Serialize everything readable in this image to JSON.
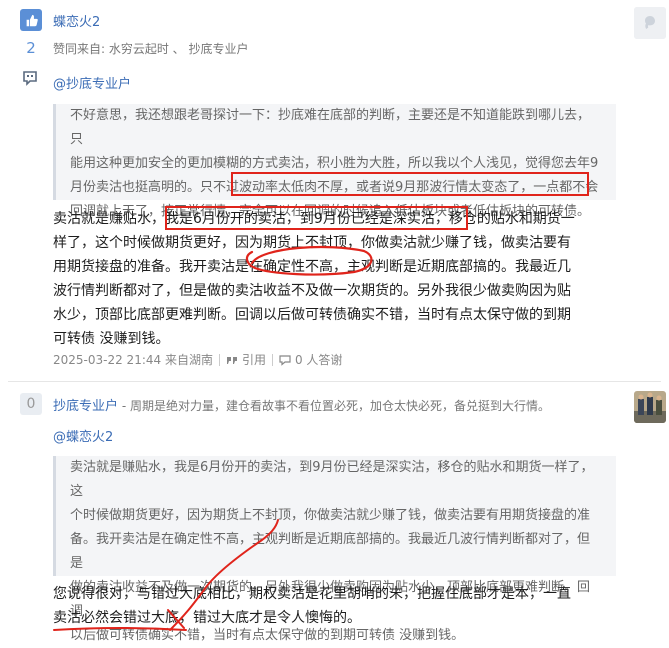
{
  "post1": {
    "author": "蝶恋火2",
    "vote_count": "2",
    "likes_line": "赞同来自: 水穷云起时 、 抄底专业户",
    "mention": "@抄底专业户",
    "quote_lines": [
      "不好意思，我还想跟老哥探讨一下：抄底难在底部的判断，主要还是不知道能跌到哪儿去，只",
      "能用这种更加安全的更加模糊的方式卖沽，积小胜为大胜，所以我以个人浅见，觉得您去年9",
      "月份卖沽也挺高明的。只不过波动率太低肉不厚，或者说9月那波行情太变态了，一点都不会",
      "回调就上天了，按正常行情，完全可以在回调的时候追入低估板块或者低估板块的可转债。"
    ],
    "body_lines": [
      "卖沽就是赚贴水，我是6月份开的卖沽，到9月份已经是深实沽，移仓的贴水和期货一",
      "样了，这个时候做期货更好，因为期货上不封顶，你做卖沽就少赚了钱，做卖沽要有",
      "用期货接盘的准备。我开卖沽是在确定性不高，主观判断是近期底部搞的。我最近几",
      "波行情判断都对了，但是做的卖沽收益不及做一次期货的。另外我很少做卖购因为贴",
      "水少，顶部比底部更难判断。回调以后做可转债确实不错，当时有点太保守做的到期",
      "可转债 没赚到钱。"
    ],
    "timestamp": "2025-03-22 21:44 来自湖南",
    "quote_action": "引用",
    "reply_count": "0 人答谢"
  },
  "post2": {
    "author": "抄底专业户",
    "vote_count": "0",
    "signature": " - 周期是绝对力量，建仓看故事不看位置必死，加仓太快必死，备兑挺到大行情。",
    "mention": "@蝶恋火2",
    "quote_lines": [
      "卖沽就是赚贴水，我是6月份开的卖沽，到9月份已经是深实沽，移仓的贴水和期货一样了，这",
      "个时候做期货更好，因为期货上不封顶，你做卖沽就少赚了钱，做卖沽要有用期货接盘的准",
      "备。我开卖沽是在确定性不高，主观判断是近期底部搞的。我最近几波行情判断都对了，但是",
      "做的卖沽收益不及做一次期货的。另外我很少做卖购因为贴水少，顶部比底部更难判断。回调",
      "以后做可转债确实不错，当时有点太保守做的到期可转债 没赚到钱。"
    ],
    "body_lines": [
      "您说得很对，与错过大底相比，期权卖沽是花里胡哨的末，把握住底部才是本，一直",
      "卖沽必然会错过大底，错过大底才是令人懊悔的。"
    ]
  },
  "colors": {
    "accent": "#5b8fd6",
    "annotation": "#e0241b"
  },
  "icons": [
    "thumb-up-icon",
    "comment-icon",
    "quote-icon",
    "reply-icon"
  ]
}
